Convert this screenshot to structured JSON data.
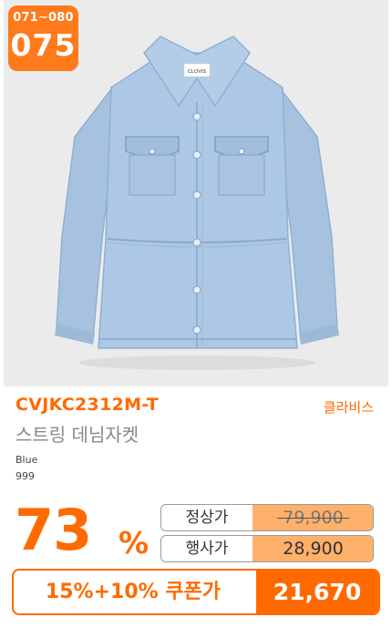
{
  "badge": {
    "range": "071~080",
    "number": "075"
  },
  "product": {
    "tag_text": "CLOVIS",
    "code": "CVJKC2312M-T",
    "brand": "클라비스",
    "name": "스트링 데님자켓",
    "color": "Blue",
    "stock": "999"
  },
  "discount": {
    "percent": "73",
    "sign": "%"
  },
  "prices": {
    "regular_label": "정상가",
    "regular_value": "79,900",
    "sale_label": "행사가",
    "sale_value": "28,900"
  },
  "coupon": {
    "label": "15%+10% 쿠폰가",
    "value": "21,670"
  },
  "colors": {
    "accent": "#ff6a00",
    "badge": "#ff7a1a",
    "price_fill": "#ffb06a",
    "denim": "#a9c4e2"
  }
}
